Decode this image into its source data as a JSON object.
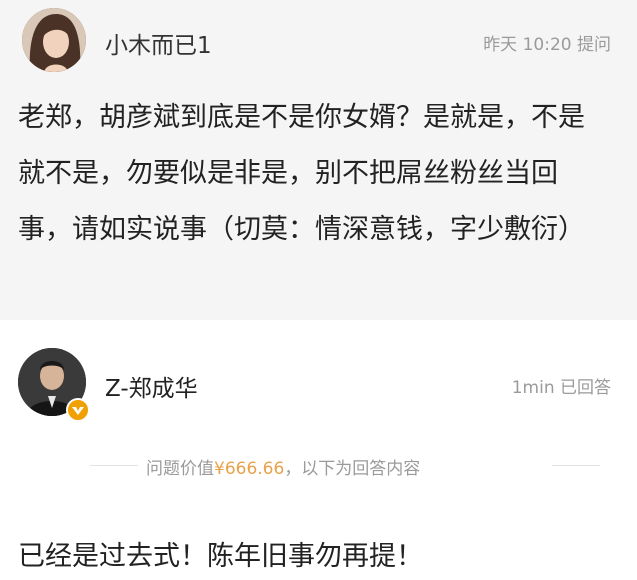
{
  "question": {
    "asker_name": "小木而已1",
    "time": "昨天 10:20",
    "action": "提问",
    "text": "老郑，胡彦斌到底是不是你女婿？是就是，不是就不是，勿要似是非是，别不把屌丝粉丝当回事，请如实说事（切莫：情深意钱，字少敷衍）"
  },
  "answer": {
    "answerer_name": "Z-郑成华",
    "time": "1min",
    "status": "已回答",
    "divider_prefix": "问题价值",
    "price": "¥666.66",
    "divider_suffix": "，以下为回答内容",
    "text": "已经是过去式！陈年旧事勿再提！"
  },
  "colors": {
    "question_bg": "#f5f5f5",
    "price": "#e8a24a",
    "meta_gray": "#9a9a9a",
    "badge": "#f0a000"
  },
  "icons": {
    "vip_badge": "verified-badge-icon"
  }
}
